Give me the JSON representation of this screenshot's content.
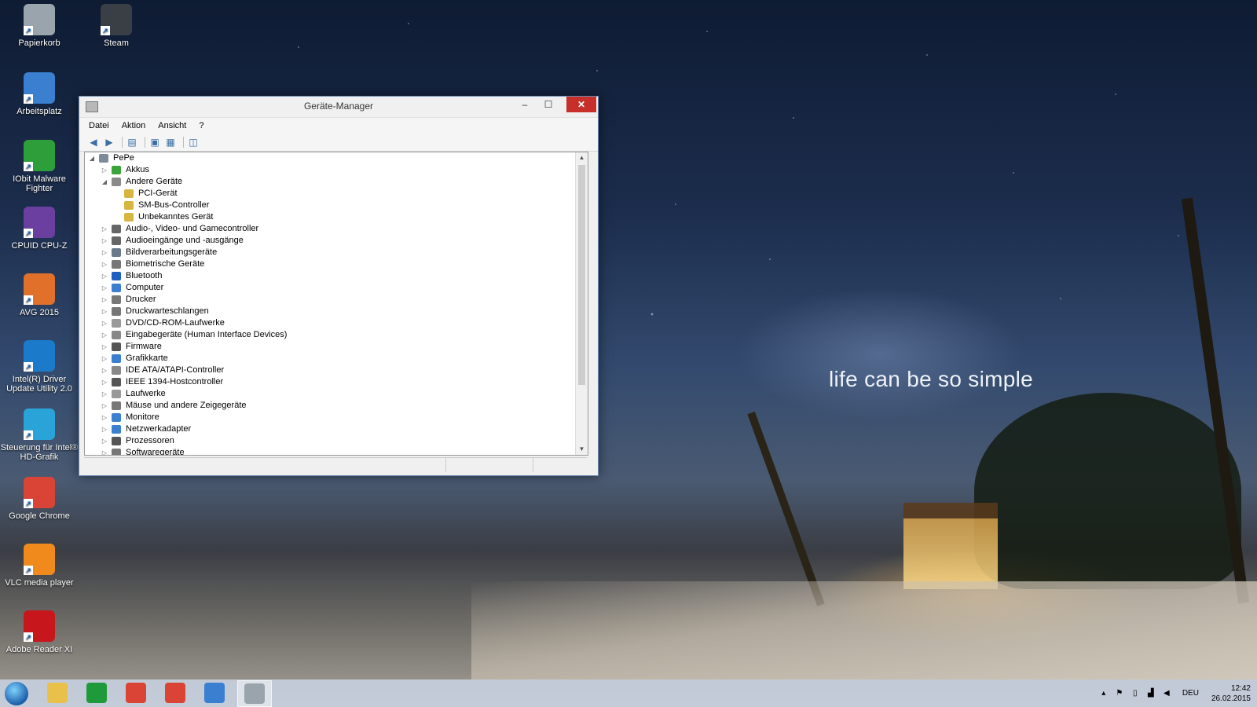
{
  "wallpaper": {
    "caption": "life can be so simple"
  },
  "desktop_icons": [
    {
      "label": "Papierkorb",
      "icon": "recycle-bin-icon",
      "color": "#9aa4ad"
    },
    {
      "label": "Steam",
      "icon": "steam-icon",
      "color": "#3a3f46"
    },
    {
      "label": "Arbeitsplatz",
      "icon": "computer-icon",
      "color": "#3b7fd0"
    },
    {
      "label": "IObit Malware Fighter",
      "icon": "iobit-icon",
      "color": "#2e9e3a"
    },
    {
      "label": "CPUID CPU-Z",
      "icon": "cpuz-icon",
      "color": "#6b3fa0"
    },
    {
      "label": "AVG 2015",
      "icon": "avg-icon",
      "color": "#e0702a"
    },
    {
      "label": "Intel(R) Driver Update Utility 2.0",
      "icon": "intel-icon",
      "color": "#1b7ac9"
    },
    {
      "label": "Steuerung für Intel® HD-Grafik",
      "icon": "intel-hd-icon",
      "color": "#2aa3d8"
    },
    {
      "label": "Google Chrome",
      "icon": "chrome-icon",
      "color": "#d94436"
    },
    {
      "label": "VLC media player",
      "icon": "vlc-icon",
      "color": "#f08a1c"
    },
    {
      "label": "Adobe Reader XI",
      "icon": "adobe-reader-icon",
      "color": "#c8161d"
    }
  ],
  "window": {
    "title": "Geräte-Manager",
    "minimize": "–",
    "maximize": "☐",
    "close": "✕",
    "menu": [
      "Datei",
      "Aktion",
      "Ansicht",
      "?"
    ]
  },
  "tree": [
    {
      "label": "PePe",
      "level": 0,
      "toggle": "◢",
      "icon_color": "#7d8a99"
    },
    {
      "label": "Akkus",
      "level": 1,
      "toggle": "▷",
      "icon_color": "#3aa33a"
    },
    {
      "label": "Andere Geräte",
      "level": 1,
      "toggle": "◢",
      "icon_color": "#8a8a8a"
    },
    {
      "label": "PCI-Gerät",
      "level": 2,
      "toggle": "",
      "icon_color": "#d6b640"
    },
    {
      "label": "SM-Bus-Controller",
      "level": 2,
      "toggle": "",
      "icon_color": "#d6b640"
    },
    {
      "label": "Unbekanntes Gerät",
      "level": 2,
      "toggle": "",
      "icon_color": "#d6b640"
    },
    {
      "label": "Audio-, Video- und Gamecontroller",
      "level": 1,
      "toggle": "▷",
      "icon_color": "#666666"
    },
    {
      "label": "Audioeingänge und -ausgänge",
      "level": 1,
      "toggle": "▷",
      "icon_color": "#666666"
    },
    {
      "label": "Bildverarbeitungsgeräte",
      "level": 1,
      "toggle": "▷",
      "icon_color": "#6a7a8a"
    },
    {
      "label": "Biometrische Geräte",
      "level": 1,
      "toggle": "▷",
      "icon_color": "#777777"
    },
    {
      "label": "Bluetooth",
      "level": 1,
      "toggle": "▷",
      "icon_color": "#1f5fbf"
    },
    {
      "label": "Computer",
      "level": 1,
      "toggle": "▷",
      "icon_color": "#3b7fd0"
    },
    {
      "label": "Drucker",
      "level": 1,
      "toggle": "▷",
      "icon_color": "#777777"
    },
    {
      "label": "Druckwarteschlangen",
      "level": 1,
      "toggle": "▷",
      "icon_color": "#777777"
    },
    {
      "label": "DVD/CD-ROM-Laufwerke",
      "level": 1,
      "toggle": "▷",
      "icon_color": "#999999"
    },
    {
      "label": "Eingabegeräte (Human Interface Devices)",
      "level": 1,
      "toggle": "▷",
      "icon_color": "#888888"
    },
    {
      "label": "Firmware",
      "level": 1,
      "toggle": "▷",
      "icon_color": "#555555"
    },
    {
      "label": "Grafikkarte",
      "level": 1,
      "toggle": "▷",
      "icon_color": "#3b7fd0"
    },
    {
      "label": "IDE ATA/ATAPI-Controller",
      "level": 1,
      "toggle": "▷",
      "icon_color": "#888888"
    },
    {
      "label": "IEEE 1394-Hostcontroller",
      "level": 1,
      "toggle": "▷",
      "icon_color": "#555555"
    },
    {
      "label": "Laufwerke",
      "level": 1,
      "toggle": "▷",
      "icon_color": "#999999"
    },
    {
      "label": "Mäuse und andere Zeigegeräte",
      "level": 1,
      "toggle": "▷",
      "icon_color": "#777777"
    },
    {
      "label": "Monitore",
      "level": 1,
      "toggle": "▷",
      "icon_color": "#3b7fd0"
    },
    {
      "label": "Netzwerkadapter",
      "level": 1,
      "toggle": "▷",
      "icon_color": "#3b7fd0"
    },
    {
      "label": "Prozessoren",
      "level": 1,
      "toggle": "▷",
      "icon_color": "#555555"
    },
    {
      "label": "Softwaregeräte",
      "level": 1,
      "toggle": "▷",
      "icon_color": "#777777"
    }
  ],
  "taskbar": {
    "apps": [
      {
        "name": "file-explorer-icon",
        "color": "#e8c04a",
        "active": false
      },
      {
        "name": "store-icon",
        "color": "#1f9a3a",
        "active": false
      },
      {
        "name": "chrome-icon",
        "color": "#d94436",
        "active": false
      },
      {
        "name": "chrome-icon",
        "color": "#d94436",
        "active": false
      },
      {
        "name": "control-panel-icon",
        "color": "#3b7fd0",
        "active": false
      },
      {
        "name": "device-manager-icon",
        "color": "#9aa4ad",
        "active": true
      }
    ],
    "tray": {
      "language": "DEU",
      "time": "12:42",
      "date": "26.02.2015"
    }
  }
}
